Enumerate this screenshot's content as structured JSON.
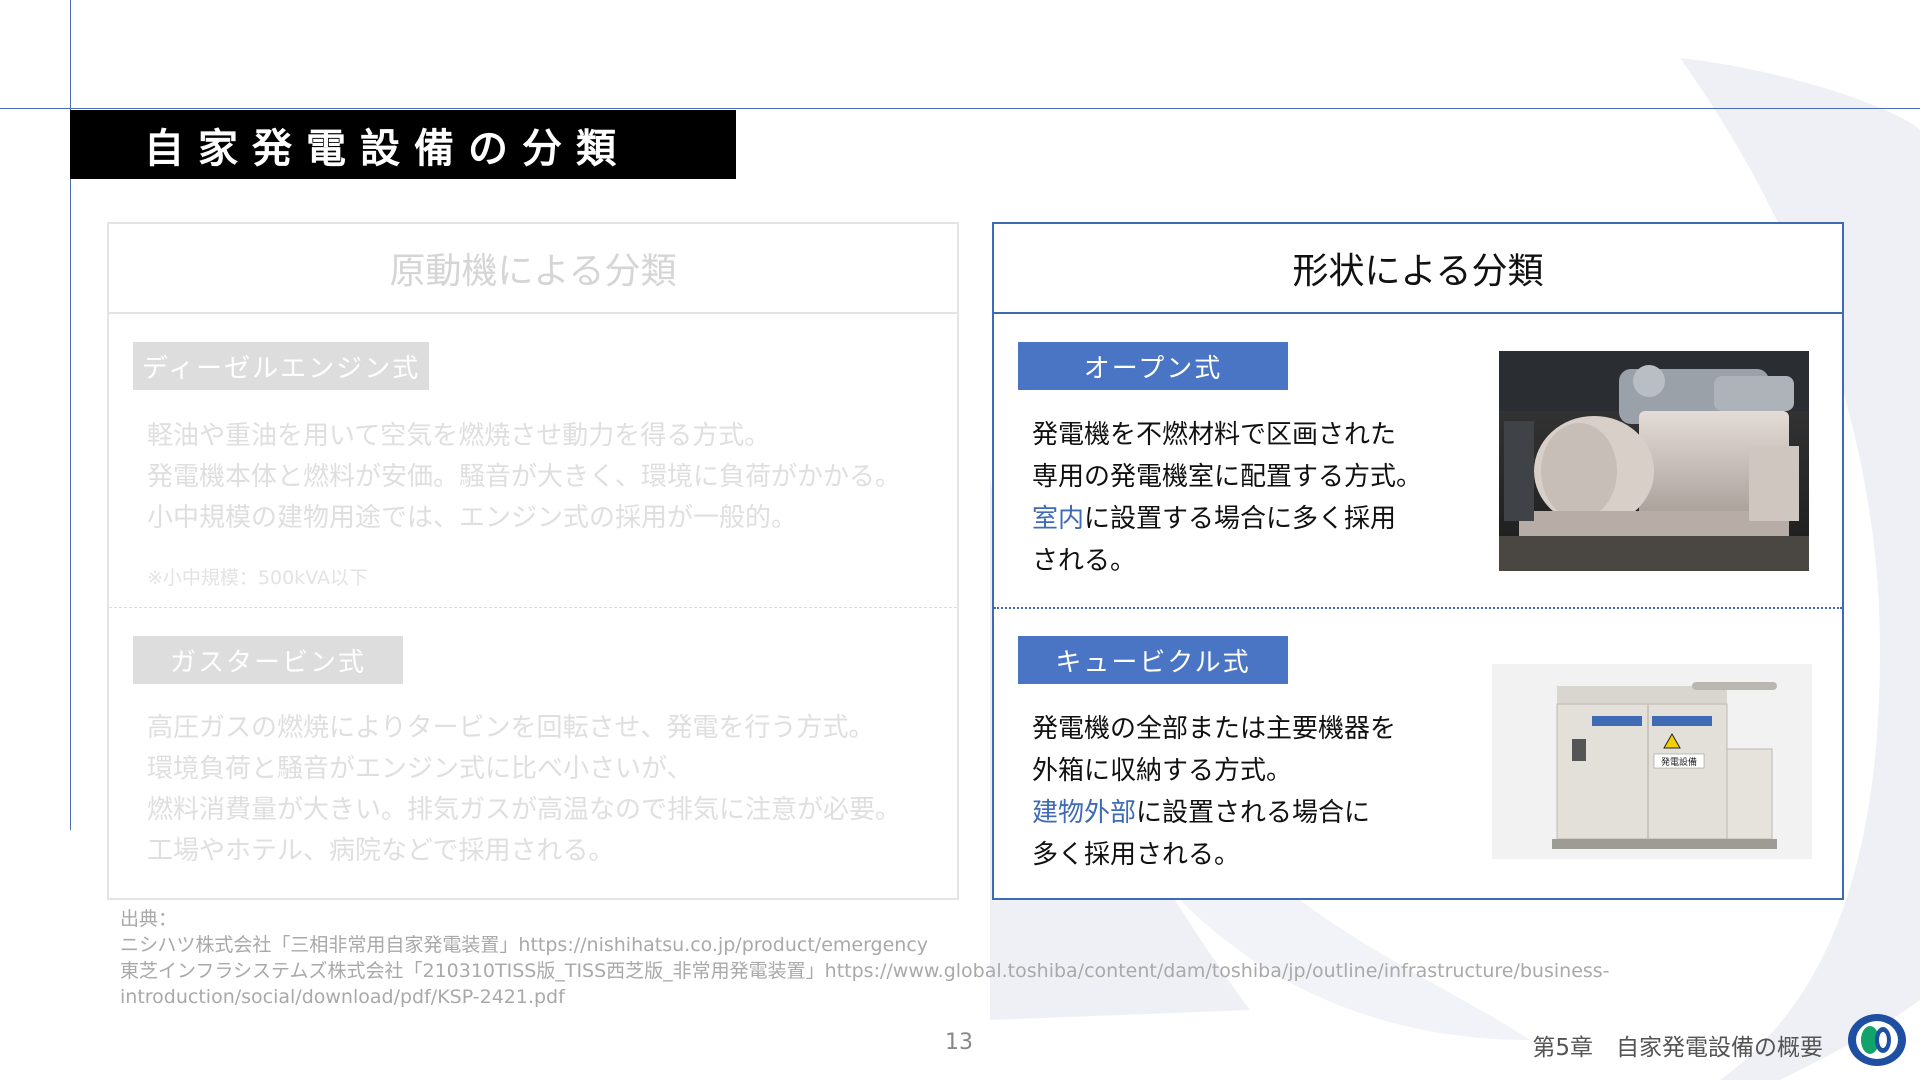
{
  "slide": {
    "title": "自家発電設備の分類",
    "page_number": "13",
    "chapter": "第5章　自家発電設備の概要"
  },
  "left_panel": {
    "heading": "原動機による分類",
    "sections": [
      {
        "tag": "ディーゼルエンジン式",
        "lines": [
          "軽油や重油を用いて空気を燃焼させ動力を得る方式。",
          "発電機本体と燃料が安価。騒音が大きく、環境に負荷がかかる。",
          "小中規模の建物用途では、エンジン式の採用が一般的。"
        ],
        "note": "※小中規模：500kVA以下"
      },
      {
        "tag": "ガスタービン式",
        "lines": [
          "高圧ガスの燃焼によりタービンを回転させ、発電を行う方式。",
          "環境負荷と騒音がエンジン式に比べ小さいが、",
          "燃料消費量が大きい。排気ガスが高温なので排気に注意が必要。",
          "工場やホテル、病院などで採用される。"
        ]
      }
    ]
  },
  "right_panel": {
    "heading": "形状による分類",
    "sections": [
      {
        "tag": "オープン式",
        "line1": "発電機を不燃材料で区画された",
        "line2": "専用の発電機室に配置する方式。",
        "line3_highlight": "室内",
        "line3_rest": "に設置する場合に多く採用",
        "line4": "される。"
      },
      {
        "tag": "キュービクル式",
        "line1": "発電機の全部または主要機器を",
        "line2": "外箱に収納する方式。",
        "line3_highlight": "建物外部",
        "line3_rest": "に設置される場合に",
        "line4": "多く採用される。",
        "cabinet_label": "発電設備"
      }
    ]
  },
  "sources": {
    "label": "出典：",
    "lines": [
      "ニシハツ株式会社「三相非常用自家発電装置」https://nishihatsu.co.jp/product/emergency",
      "東芝インフラシステムズ株式会社「210310TISS版_TISS西芝版_非常用発電装置」https://www.global.toshiba/content/dam/toshiba/jp/outline/infrastructure/business-",
      "introduction/social/download/pdf/KSP-2421.pdf"
    ]
  },
  "colors": {
    "accent": "#3f6bb5",
    "tag_blue": "#4a74c4",
    "title_bar": "#000000",
    "faded_text": "#dfdfdf"
  }
}
